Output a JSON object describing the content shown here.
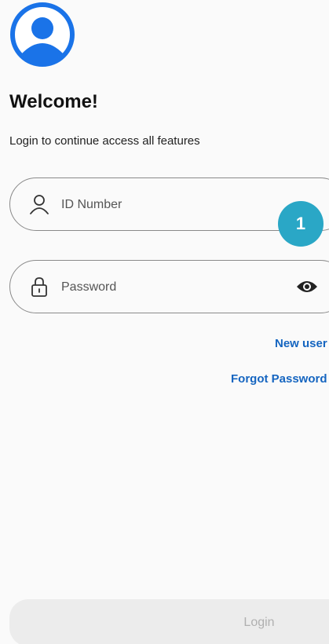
{
  "header": {
    "logo_icon": "user-avatar-icon",
    "title": "Welcome!",
    "subtitle": "Login to continue access all features"
  },
  "form": {
    "id_field": {
      "icon": "person-icon",
      "placeholder": "ID Number"
    },
    "password_field": {
      "icon": "lock-icon",
      "placeholder": "Password",
      "toggle_icon": "eye-icon"
    },
    "badge_label": "1",
    "new_user_label": "New user",
    "forgot_password_label": "Forgot Password"
  },
  "footer": {
    "login_label": "Login"
  },
  "colors": {
    "brand_blue": "#1a73e8",
    "link_blue": "#1565c0",
    "badge_teal": "#2aa7c6",
    "disabled_button": "#ececec"
  }
}
